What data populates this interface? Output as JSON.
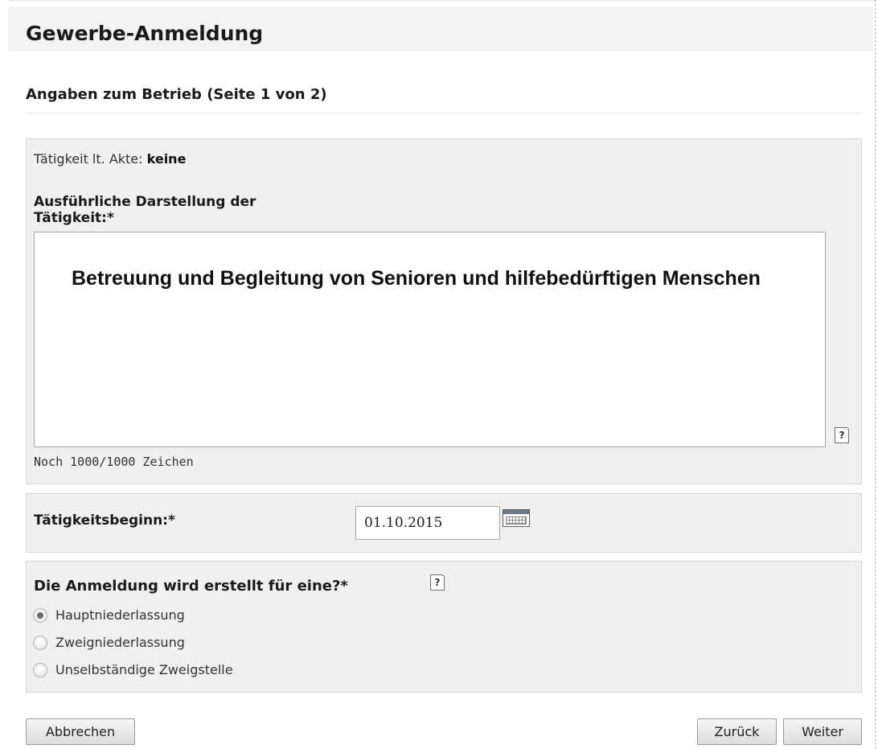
{
  "page": {
    "title": "Gewerbe-Anmeldung",
    "section_title": "Angaben zum Betrieb (Seite 1 von 2)"
  },
  "activity": {
    "akte_prefix": "Tätigkeit lt. Akte: ",
    "akte_value": "keine",
    "description_label": "Ausführliche Darstellung der Tätigkeit:*",
    "description_value": "Betreuung und Begleitung von Senioren und hilfebedürftigen Menschen",
    "char_counter": "Noch 1000/1000 Zeichen",
    "help_icon": "help-page-icon"
  },
  "start": {
    "label": "Tätigkeitsbeginn:*",
    "date_value": "01.10.2015",
    "calendar_icon": "calendar-icon"
  },
  "registration_type": {
    "question": "Die Anmeldung wird erstellt für eine?*",
    "help_icon": "help-page-icon",
    "options": [
      {
        "label": "Hauptniederlassung",
        "checked": true
      },
      {
        "label": "Zweigniederlassung",
        "checked": false
      },
      {
        "label": "Unselbständige Zweigstelle",
        "checked": false
      }
    ]
  },
  "buttons": {
    "cancel": "Abbrechen",
    "back": "Zurück",
    "next": "Weiter"
  },
  "colors": {
    "panel_background": "#f0f0f0",
    "header_background": "#f3f3f3",
    "border": "#d6d6d6"
  }
}
